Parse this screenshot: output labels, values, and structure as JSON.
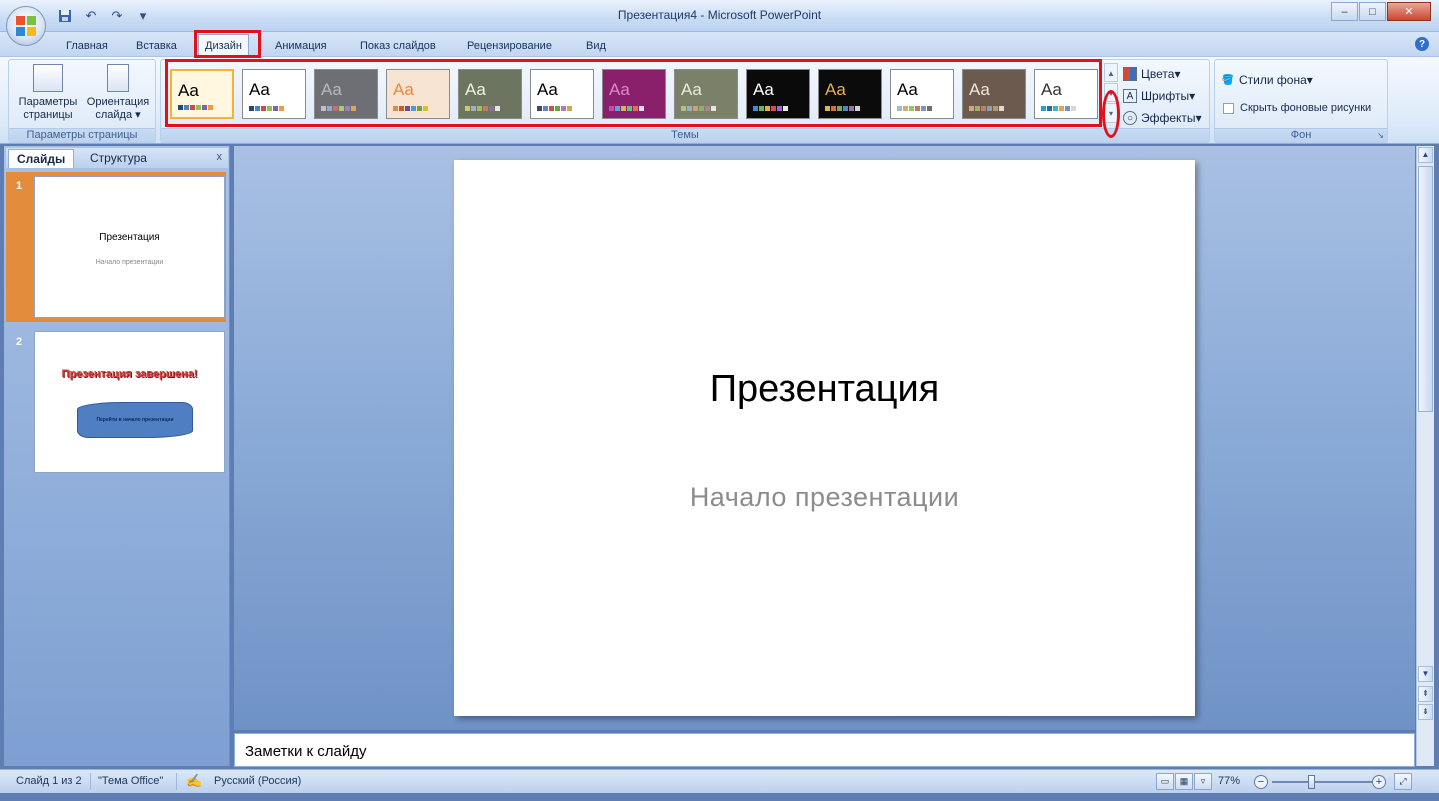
{
  "window": {
    "title": "Презентация4 - Microsoft PowerPoint"
  },
  "quick_access": {
    "icons": [
      "save-icon",
      "undo-icon",
      "redo-icon",
      "customize-icon"
    ]
  },
  "ribbon_tabs": [
    "Главная",
    "Вставка",
    "Дизайн",
    "Анимация",
    "Показ слайдов",
    "Рецензирование",
    "Вид"
  ],
  "active_tab": "Дизайн",
  "page_setup_group": {
    "label": "Параметры страницы",
    "page_setup_btn": "Параметры страницы",
    "orientation_btn": "Ориентация слайда"
  },
  "themes_group": {
    "label": "Темы",
    "themes": [
      {
        "bg": "#ffffff",
        "fg": "#000000",
        "sw": [
          "#1f497d",
          "#4f81bd",
          "#c0504d",
          "#9bbb59",
          "#8064a2",
          "#f79646"
        ],
        "selected": true
      },
      {
        "bg": "#ffffff",
        "fg": "#000000",
        "sw": [
          "#1f497d",
          "#4f81bd",
          "#c0504d",
          "#9bbb59",
          "#8064a2",
          "#f79646"
        ]
      },
      {
        "bg": "#6d6f75",
        "fg": "#b7b7c4",
        "sw": [
          "#bfbfbf",
          "#92a9cf",
          "#d06a6a",
          "#b2c86e",
          "#9b80b8",
          "#e6a05a"
        ]
      },
      {
        "bg": "#f7e3d2",
        "fg": "#e8883c",
        "sw": [
          "#e8883c",
          "#c85a32",
          "#6f4a9a",
          "#4f9ad0",
          "#6ca53c",
          "#d1c233"
        ]
      },
      {
        "bg": "#6b7560",
        "fg": "#f2f2dc",
        "sw": [
          "#d3c56a",
          "#9bb1c9",
          "#a5c05a",
          "#c87a5a",
          "#8c6ba6",
          "#e6e6e6"
        ]
      },
      {
        "bg": "#ffffff",
        "fg": "#000000",
        "sw": [
          "#3b4a6b",
          "#6d7fb3",
          "#b85c3d",
          "#6fa04a",
          "#a87fb0",
          "#d9a441"
        ]
      },
      {
        "bg": "#8a1f6b",
        "fg": "#d98ad0",
        "sw": [
          "#c24ca6",
          "#5aa6d6",
          "#d6b55a",
          "#6cc07a",
          "#e06b6b",
          "#e0e0e0"
        ]
      },
      {
        "bg": "#7b8068",
        "fg": "#e9edd5",
        "sw": [
          "#b5c17a",
          "#9ab0b8",
          "#d0a070",
          "#8db070",
          "#b08090",
          "#e5e5e5"
        ]
      },
      {
        "bg": "#0a0a0a",
        "fg": "#ffffff",
        "sw": [
          "#3d8cd6",
          "#5bbf4c",
          "#e0b23b",
          "#d94a4a",
          "#9a6ad0",
          "#e8e8e8"
        ]
      },
      {
        "bg": "#0b0b0b",
        "fg": "#e6b04a",
        "sw": [
          "#e6b04a",
          "#c9743a",
          "#7fa64a",
          "#4f89b8",
          "#9a6fa8",
          "#d0d0d0"
        ]
      },
      {
        "bg": "#ffffff",
        "fg": "#000000",
        "sw": [
          "#a8b8c8",
          "#c9b36e",
          "#9fbf6a",
          "#c27c68",
          "#8790b8",
          "#6f6f6f"
        ]
      },
      {
        "bg": "#6b5a4d",
        "fg": "#f2e6d6",
        "sw": [
          "#d9a679",
          "#a6b06c",
          "#c77d5a",
          "#8d9fb8",
          "#b89a6a",
          "#e6d6c6"
        ]
      },
      {
        "bg": "#ffffff",
        "fg": "#333333",
        "sw": [
          "#2aa1c0",
          "#2a6aa8",
          "#45b6a0",
          "#e6a34a",
          "#7c8ec4",
          "#d9d9d9"
        ]
      }
    ],
    "colors_btn": "Цвета",
    "fonts_btn": "Шрифты",
    "effects_btn": "Эффекты"
  },
  "background_group": {
    "label": "Фон",
    "bg_styles_btn": "Стили фона",
    "hide_bg_label": "Скрыть фоновые рисунки"
  },
  "panel": {
    "tab_slides": "Слайды",
    "tab_outline": "Структура",
    "close": "x",
    "slides": [
      {
        "num": "1",
        "title": "Презентация",
        "subtitle": "Начало презентации"
      },
      {
        "num": "2",
        "title": "Презентация завершена!",
        "banner": "Перейти в начало презентации"
      }
    ]
  },
  "slide": {
    "title": "Презентация",
    "subtitle": "Начало презентации"
  },
  "notes": {
    "placeholder": "Заметки к слайду"
  },
  "status": {
    "slide_count": "Слайд 1 из 2",
    "theme": "\"Тема Office\"",
    "language": "Русский (Россия)",
    "zoom": "77%",
    "zoom_level": 0.77
  }
}
